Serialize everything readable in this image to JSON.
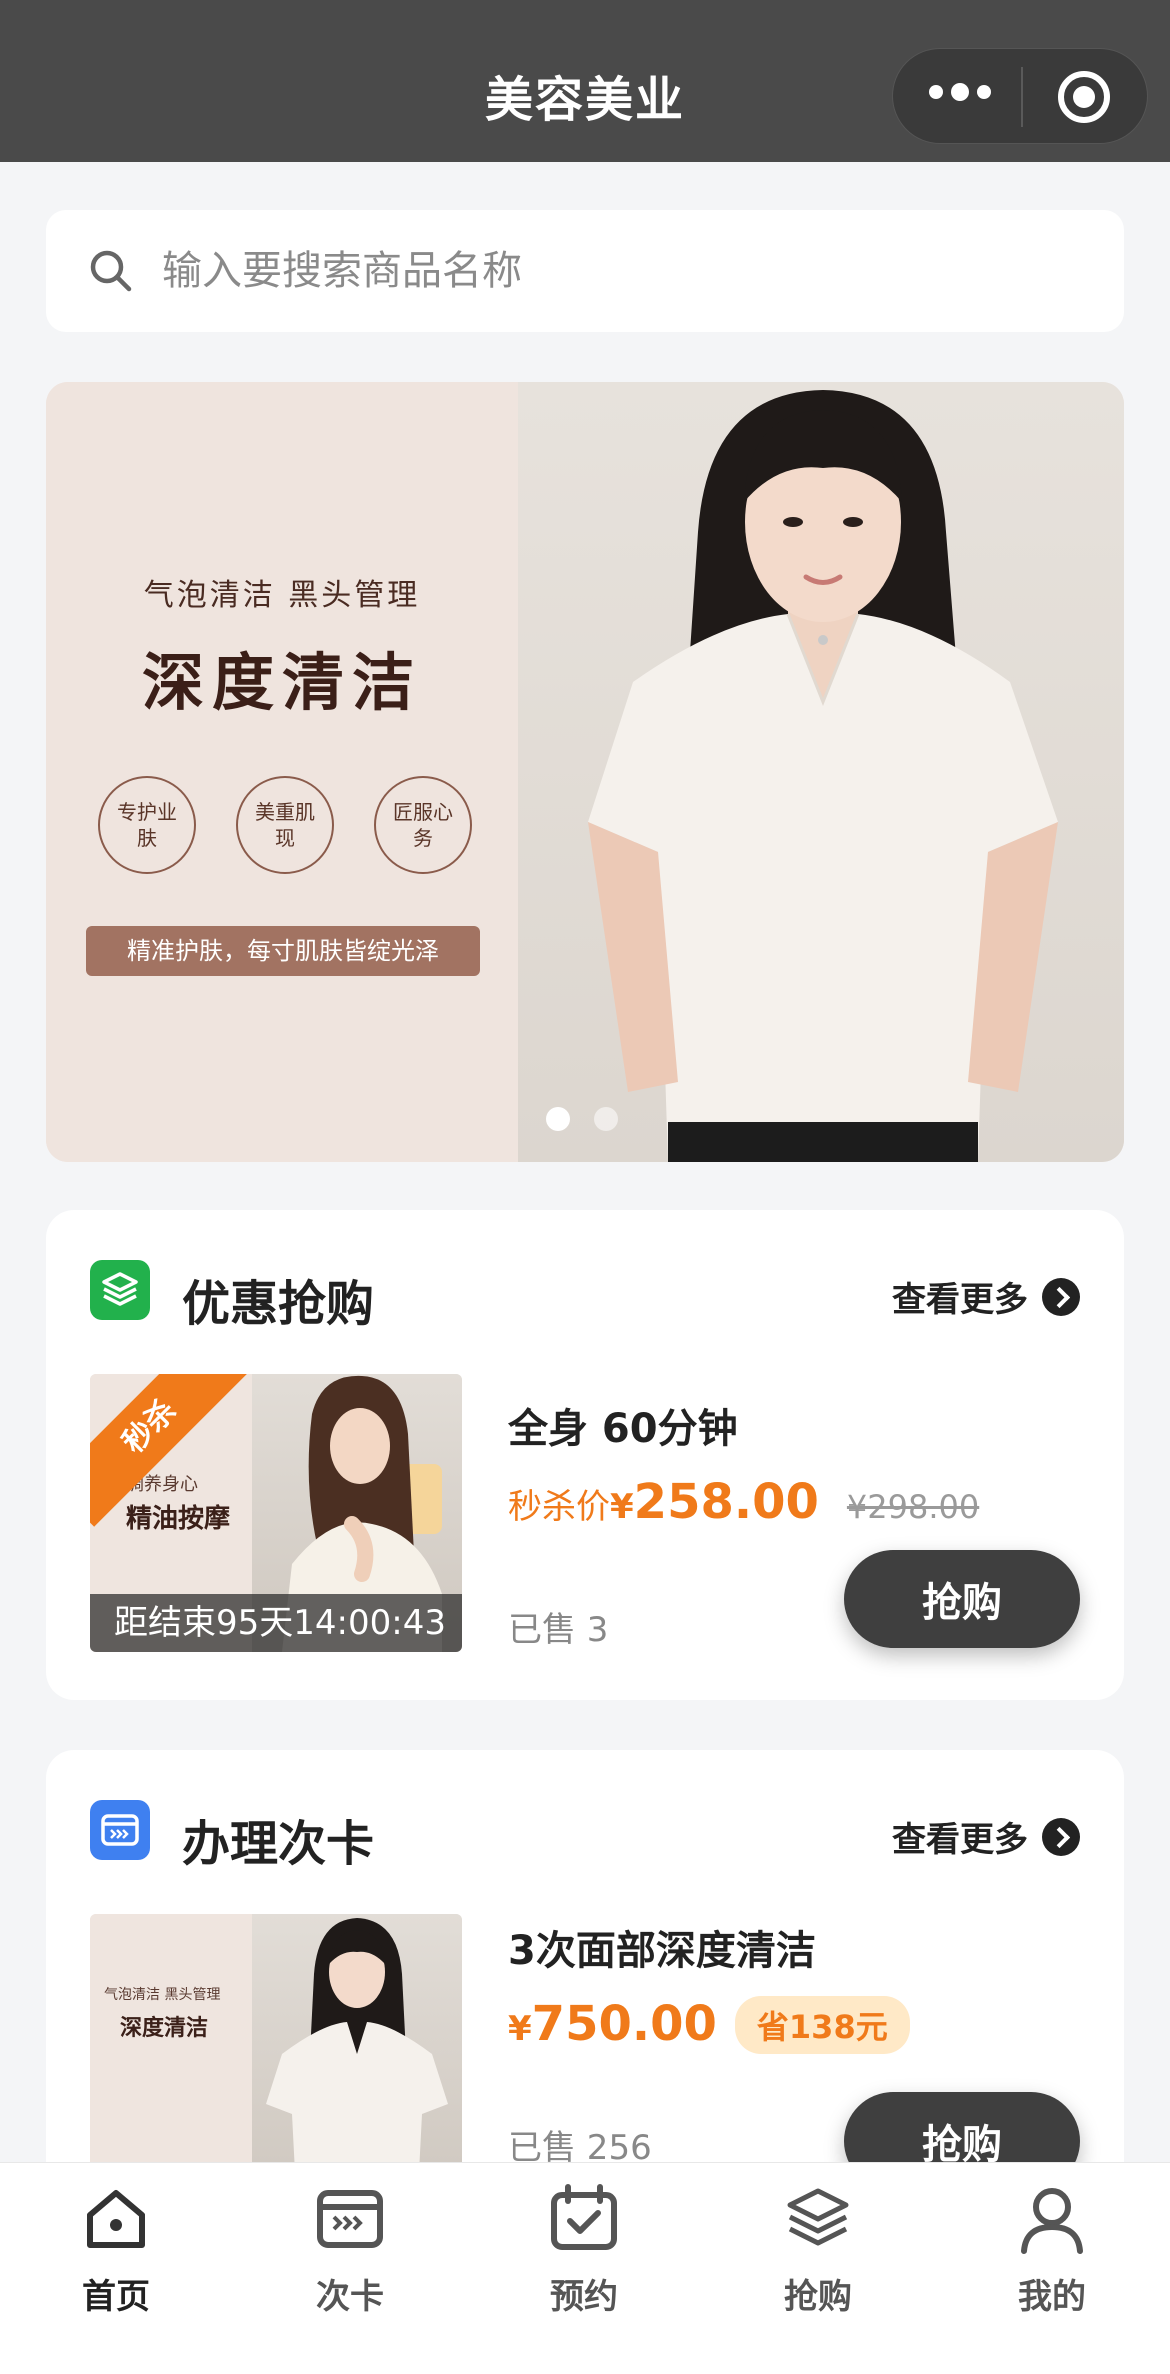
{
  "header": {
    "title": "美容美业"
  },
  "search": {
    "placeholder": "输入要搜索商品名称"
  },
  "banner": {
    "subtitle": "气泡清洁 黑头管理",
    "title": "深度清洁",
    "badges": [
      "专护业肤",
      "美重肌现",
      "匠服心务"
    ],
    "tagline": "精准护肤，每寸肌肤皆绽光泽",
    "indicator_count": 2,
    "indicator_active": 0
  },
  "flash_sale": {
    "title": "优惠抢购",
    "more": "查看更多",
    "product": {
      "ribbon": "秒杀",
      "thumb_small": "调养身心",
      "thumb_big": "精油按摩",
      "countdown": "距结束95天14:00:43",
      "name": "全身 60分钟",
      "price_label": "秒杀价",
      "currency": "¥",
      "price": "258.00",
      "original_price": "¥298.00",
      "sold": "已售 3",
      "buy_label": "抢购"
    }
  },
  "card_section": {
    "title": "办理次卡",
    "more": "查看更多",
    "product": {
      "thumb_small": "气泡清洁 黑头管理",
      "thumb_big": "深度清洁",
      "name": "3次面部深度清洁",
      "currency": "¥",
      "price": "750.00",
      "save": "省138元",
      "sold": "已售 256",
      "buy_label": "抢购"
    }
  },
  "tabbar": {
    "items": [
      {
        "label": "首页",
        "icon": "home-icon",
        "active": true
      },
      {
        "label": "次卡",
        "icon": "card-icon",
        "active": false
      },
      {
        "label": "预约",
        "icon": "calendar-icon",
        "active": false
      },
      {
        "label": "抢购",
        "icon": "layers-icon",
        "active": false
      },
      {
        "label": "我的",
        "icon": "user-icon",
        "active": false
      }
    ]
  },
  "colors": {
    "accent": "#f07a1a",
    "header": "#4a4a4a",
    "button": "#3f3f3f",
    "green_icon": "#22b14c",
    "blue_icon": "#3f80f0"
  }
}
